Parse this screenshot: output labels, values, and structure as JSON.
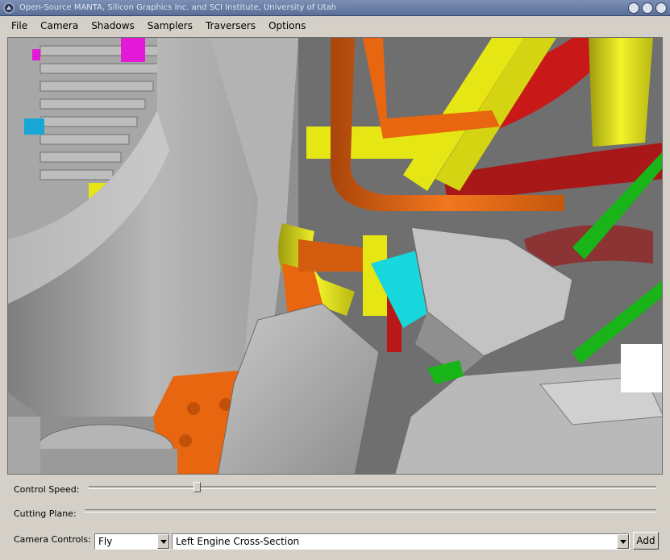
{
  "window": {
    "title": "Open-Source MANTA, Silicon Graphics Inc. and SCI Institute, University of Utah"
  },
  "menu": [
    "File",
    "Camera",
    "Shadows",
    "Samplers",
    "Traversers",
    "Options"
  ],
  "controls": {
    "control_speed_label": "Control Speed:",
    "control_speed_value": 0.19,
    "cutting_plane_label": "Cutting Plane:",
    "camera_controls_label": "Camera Controls:",
    "camera_mode": "Fly",
    "camera_bookmark": "Left Engine Cross-Section",
    "add_label": "Add"
  },
  "colors": {
    "title_bar": "#5a6f98",
    "background": "#d4d0c8",
    "orange": "#e8660f",
    "yellow": "#e6e615",
    "red": "#c81818",
    "green": "#18b418",
    "cyan": "#17d6dc",
    "magenta": "#e21ad8",
    "gray": "#b5b5b5"
  }
}
